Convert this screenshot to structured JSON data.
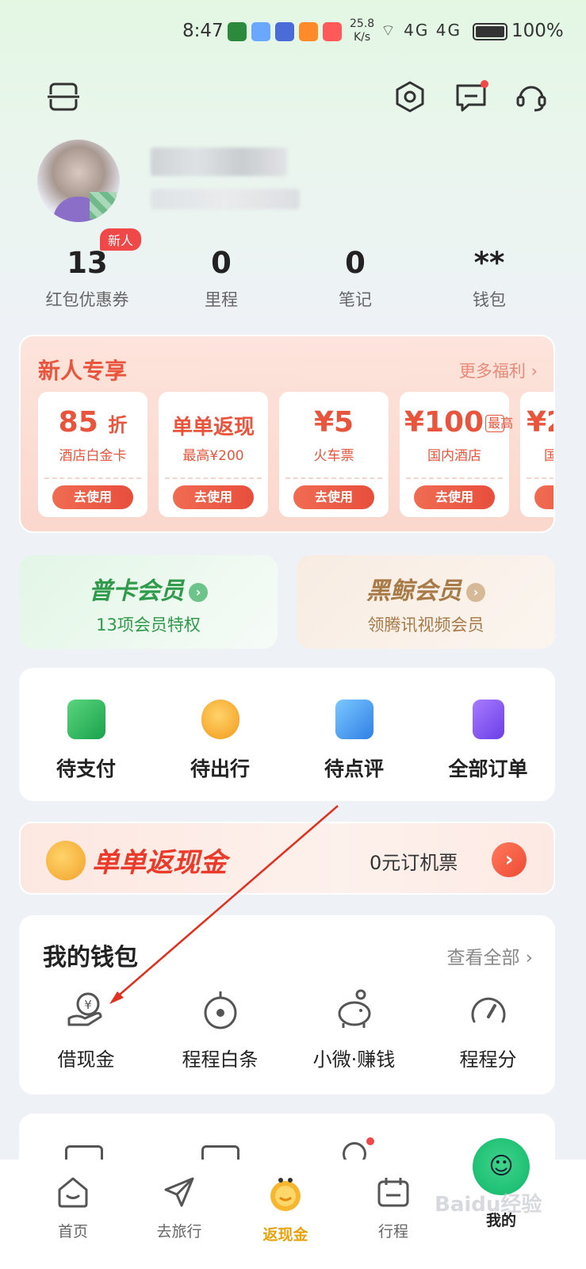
{
  "status_bar": {
    "time": "8:47",
    "speed_value": "25.8",
    "speed_unit": "K/s",
    "network": "4G 4G",
    "battery": "100%"
  },
  "header": {
    "scan_icon": "scan-icon",
    "settings_icon": "settings-icon",
    "message_icon": "message-icon",
    "service_icon": "headset-icon"
  },
  "profile": {
    "badge": "新人"
  },
  "stats": [
    {
      "value": "13",
      "label": "红包优惠券"
    },
    {
      "value": "0",
      "label": "里程"
    },
    {
      "value": "0",
      "label": "笔记"
    },
    {
      "value": "**",
      "label": "钱包"
    }
  ],
  "new_user": {
    "title": "新人专享",
    "more": "更多福利 ›",
    "coupons": [
      {
        "main": "85",
        "unit": "折",
        "sub": "酒店白金卡",
        "button": "去使用"
      },
      {
        "main": "单单返现",
        "unit": "",
        "sub": "最高¥200",
        "button": "去使用"
      },
      {
        "main": "¥5",
        "unit": "",
        "sub": "火车票",
        "button": "去使用"
      },
      {
        "main": "¥100",
        "unit": "最高",
        "sub": "国内酒店",
        "button": "去使用"
      },
      {
        "main": "¥2",
        "unit": "",
        "sub": "国",
        "button": "去使用"
      }
    ]
  },
  "members": [
    {
      "title": "普卡会员",
      "sub": "13项会员特权",
      "color": "#2f9a4a",
      "arrow_bg": "#6cc48a"
    },
    {
      "title": "黑鲸会员",
      "sub": "领腾讯视频会员",
      "color": "#a77a47",
      "arrow_bg": "#d6b996"
    }
  ],
  "orders": [
    {
      "label": "待支付",
      "icon": "wallet-icon",
      "color": "#26b35a"
    },
    {
      "label": "待出行",
      "icon": "clock-icon",
      "color": "#f5a623"
    },
    {
      "label": "待点评",
      "icon": "chat-bubble-icon",
      "color": "#3b8fea"
    },
    {
      "label": "全部订单",
      "icon": "order-list-icon",
      "color": "#7b4ef0"
    }
  ],
  "banner": {
    "title": "单单返现金",
    "cta": "0元订机票",
    "go": "›"
  },
  "wallet": {
    "title": "我的钱包",
    "more": "查看全部 ›",
    "items": [
      {
        "label": "借现金",
        "icon": "cash-loan-icon"
      },
      {
        "label": "程程白条",
        "icon": "credit-icon"
      },
      {
        "label": "小微·赚钱",
        "icon": "piggy-bank-icon"
      },
      {
        "label": "程程分",
        "icon": "score-gauge-icon"
      }
    ]
  },
  "tabbar": [
    {
      "label": "首页",
      "icon": "home-icon",
      "active": false
    },
    {
      "label": "去旅行",
      "icon": "paper-plane-icon",
      "active": false
    },
    {
      "label": "返现金",
      "icon": "cashback-icon",
      "active": true
    },
    {
      "label": "行程",
      "icon": "calendar-icon",
      "active": false
    },
    {
      "label": "我的",
      "icon": "profile-smiley-icon",
      "active": false
    }
  ],
  "watermark": "Baidu经验"
}
